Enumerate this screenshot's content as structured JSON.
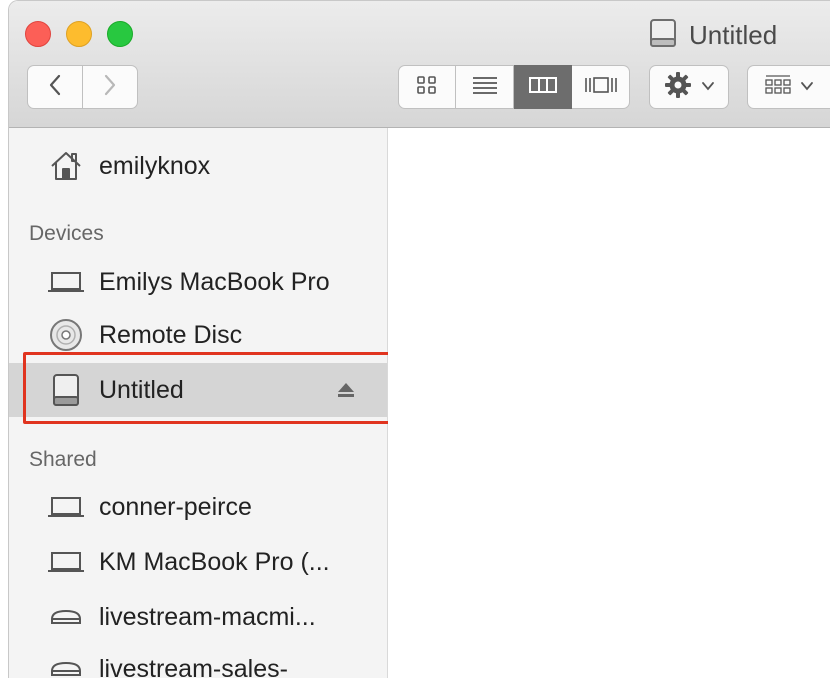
{
  "window": {
    "title": "Untitled",
    "title_icon": "drive-icon"
  },
  "toolbar": {
    "back_icon": "chevron-left-icon",
    "forward_icon": "chevron-right-icon",
    "views": [
      {
        "name": "icon-view",
        "icon": "grid-icon",
        "active": false
      },
      {
        "name": "list-view",
        "icon": "list-icon",
        "active": false
      },
      {
        "name": "column-view",
        "icon": "columns-icon",
        "active": true
      },
      {
        "name": "gallery-view",
        "icon": "cover-flow-icon",
        "active": false
      }
    ],
    "action_icon": "gear-icon",
    "arrange_icon": "arrange-grid-icon"
  },
  "sidebar": {
    "home": {
      "label": "emilyknox",
      "icon": "home-icon"
    },
    "devices_header": "Devices",
    "devices": [
      {
        "label": "Emilys MacBook Pro",
        "icon": "laptop-icon"
      },
      {
        "label": "Remote Disc",
        "icon": "disc-icon"
      },
      {
        "label": "Untitled",
        "icon": "drive-icon",
        "selected": true,
        "eject": true
      }
    ],
    "shared_header": "Shared",
    "shared": [
      {
        "label": "conner-peirce",
        "icon": "laptop-icon"
      },
      {
        "label": "KM MacBook Pro (...",
        "icon": "laptop-icon"
      },
      {
        "label": "livestream-macmi...",
        "icon": "server-icon"
      },
      {
        "label": "livestream-sales-",
        "icon": "server-icon"
      }
    ]
  },
  "colors": {
    "highlight": "#e0341f",
    "selected_row": "#d5d5d5",
    "active_view": "#6d6d6d"
  }
}
